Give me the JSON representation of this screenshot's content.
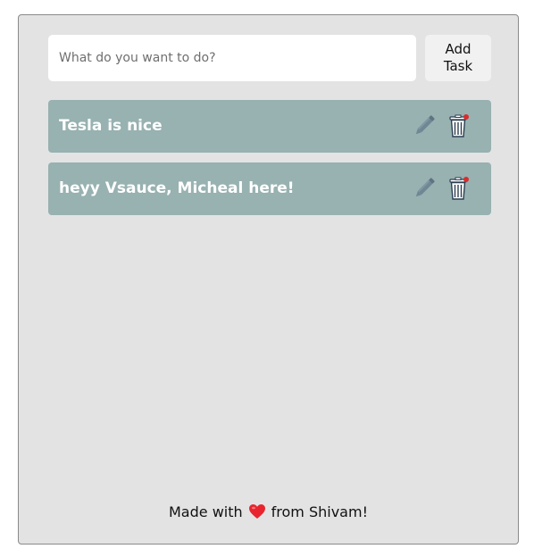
{
  "input": {
    "placeholder": "What do you want to do?",
    "value": ""
  },
  "add_button": {
    "label": "Add Task"
  },
  "tasks": [
    {
      "text": "Tesla is nice",
      "edit_icon": "pencil-icon",
      "delete_icon": "trash-icon"
    },
    {
      "text": "heyy Vsauce, Micheal here!",
      "edit_icon": "pencil-icon",
      "delete_icon": "trash-icon"
    }
  ],
  "footer": {
    "prefix": "Made with",
    "icon": "heart-icon",
    "suffix": "from Shivam!"
  },
  "colors": {
    "panel_bg": "#e3e3e3",
    "task_bg": "#98b1b1",
    "task_text": "#ffffff",
    "heart": "#e8252f"
  }
}
